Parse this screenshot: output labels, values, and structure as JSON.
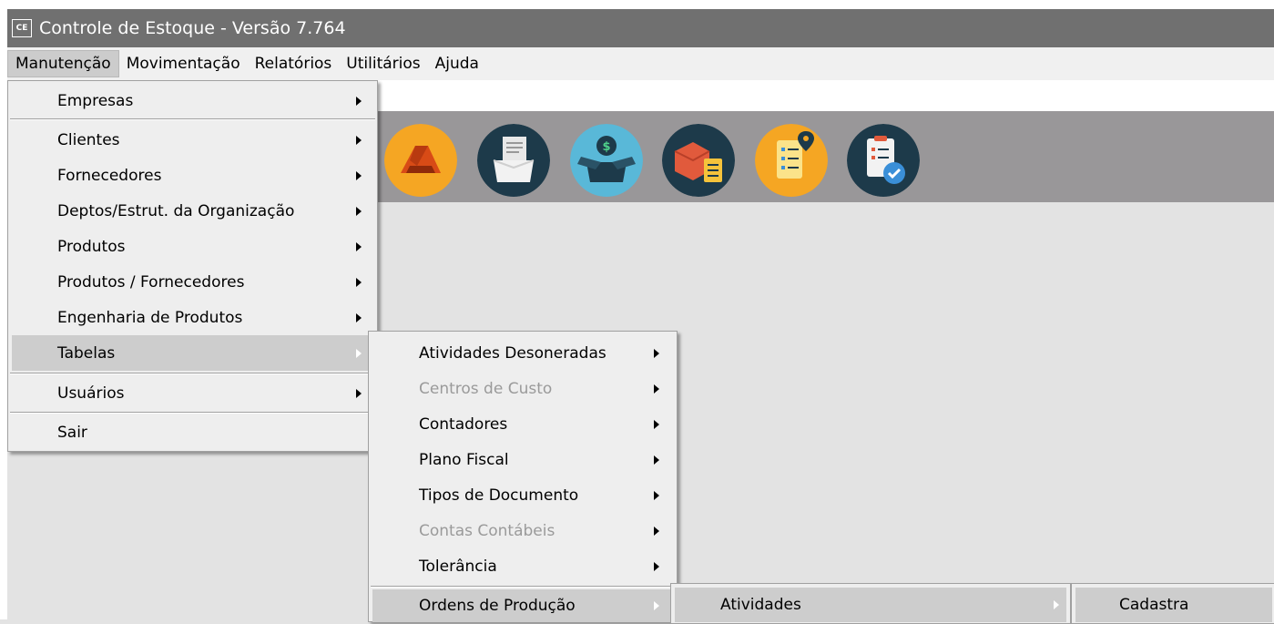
{
  "window": {
    "app_icon_text": "CE",
    "title": "Controle de Estoque - Versão 7.764"
  },
  "menubar": [
    "Manutenção",
    "Movimentação",
    "Relatórios",
    "Utilitários",
    "Ajuda"
  ],
  "manutencao_menu": [
    {
      "label": "Empresas"
    },
    {
      "label": "Clientes"
    },
    {
      "label": "Fornecedores"
    },
    {
      "label": "Deptos/Estrut. da Organização"
    },
    {
      "label": "Produtos"
    },
    {
      "label": "Produtos / Fornecedores"
    },
    {
      "label": "Engenharia de Produtos"
    },
    {
      "label": "Tabelas"
    },
    {
      "label": "Usuários"
    },
    {
      "label": "Sair"
    }
  ],
  "tabelas_menu": [
    {
      "label": "Atividades Desoneradas"
    },
    {
      "label": "Centros de Custo",
      "disabled": true
    },
    {
      "label": "Contadores"
    },
    {
      "label": "Plano Fiscal"
    },
    {
      "label": "Tipos de Documento"
    },
    {
      "label": "Contas Contábeis",
      "disabled": true
    },
    {
      "label": "Tolerância"
    },
    {
      "label": "Ordens de Produção"
    }
  ],
  "ordens_menu": [
    {
      "label": "Atividades"
    }
  ],
  "atividades_menu": [
    {
      "label": "Cadastra"
    }
  ],
  "toolbar_icons": [
    "drive-icon",
    "document-box-icon",
    "money-box-icon",
    "product-checklist-icon",
    "location-checklist-icon",
    "approved-checklist-icon"
  ],
  "colors": {
    "titlebar": "#707070",
    "toolbar": "#999799",
    "highlight": "#cdcdcd",
    "disabled_text": "#9a9a9a"
  }
}
